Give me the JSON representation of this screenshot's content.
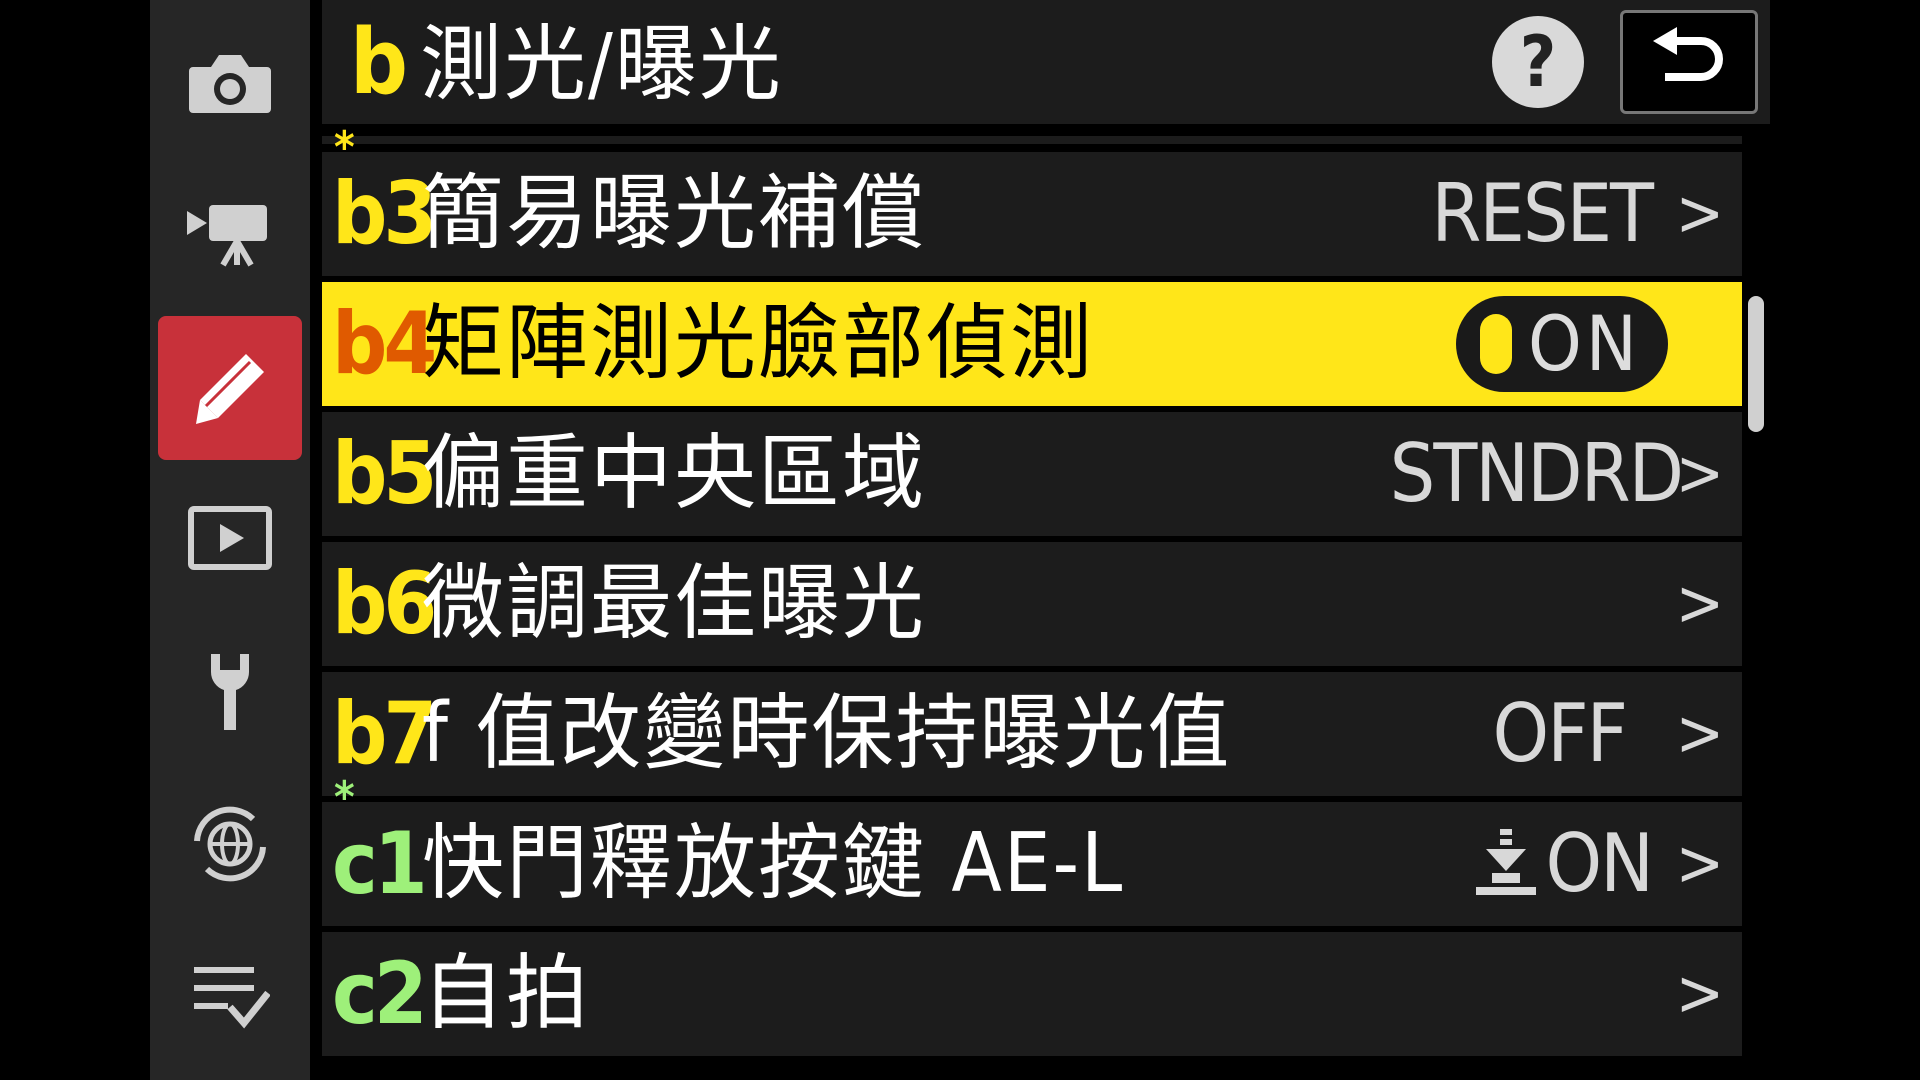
{
  "header": {
    "letter": "b",
    "title": "測光/曝光",
    "help_label": "?"
  },
  "sidebar": {
    "items": [
      {
        "name": "photo-shooting-menu",
        "icon": "camera-icon",
        "active": false
      },
      {
        "name": "movie-recording-menu",
        "icon": "movie-camera-icon",
        "active": false
      },
      {
        "name": "custom-settings-menu",
        "icon": "pencil-icon",
        "active": true
      },
      {
        "name": "playback-menu",
        "icon": "play-icon",
        "active": false
      },
      {
        "name": "setup-menu",
        "icon": "wrench-icon",
        "active": false
      },
      {
        "name": "network-menu",
        "icon": "globe-icon",
        "active": false
      },
      {
        "name": "my-menu",
        "icon": "checklist-icon",
        "active": false
      }
    ]
  },
  "menu": {
    "rows": [
      {
        "star": "*",
        "code": "b3",
        "label": "簡易曝光補償",
        "value": "RESET",
        "chevron": ">",
        "code_color": "#ffe619"
      },
      {
        "star": "",
        "code": "b4",
        "label": "矩陣測光臉部偵測",
        "value": "ON",
        "chevron": "",
        "code_color": "#e05a00"
      },
      {
        "star": "",
        "code": "b5",
        "label": "偏重中央區域",
        "value": "STNDRD",
        "chevron": ">",
        "code_color": "#ffe619"
      },
      {
        "star": "",
        "code": "b6",
        "label": "微調最佳曝光",
        "value": "",
        "chevron": ">",
        "code_color": "#ffe619"
      },
      {
        "star": "",
        "code": "b7",
        "label": "f 值改變時保持曝光值",
        "value": "OFF",
        "chevron": ">",
        "code_color": "#ffe619"
      },
      {
        "star": "*",
        "code": "c1",
        "label": "快門釋放按鍵 AE-L",
        "value": "ON",
        "chevron": ">",
        "code_color": "#9ef07a",
        "value_icon": "half-press-icon"
      },
      {
        "star": "",
        "code": "c2",
        "label": "自拍",
        "value": "",
        "chevron": ">",
        "code_color": "#9ef07a"
      }
    ]
  },
  "colors": {
    "accent_yellow": "#ffe619",
    "active_tab_red": "#c8313a",
    "row_bg": "#1c1c1c"
  }
}
